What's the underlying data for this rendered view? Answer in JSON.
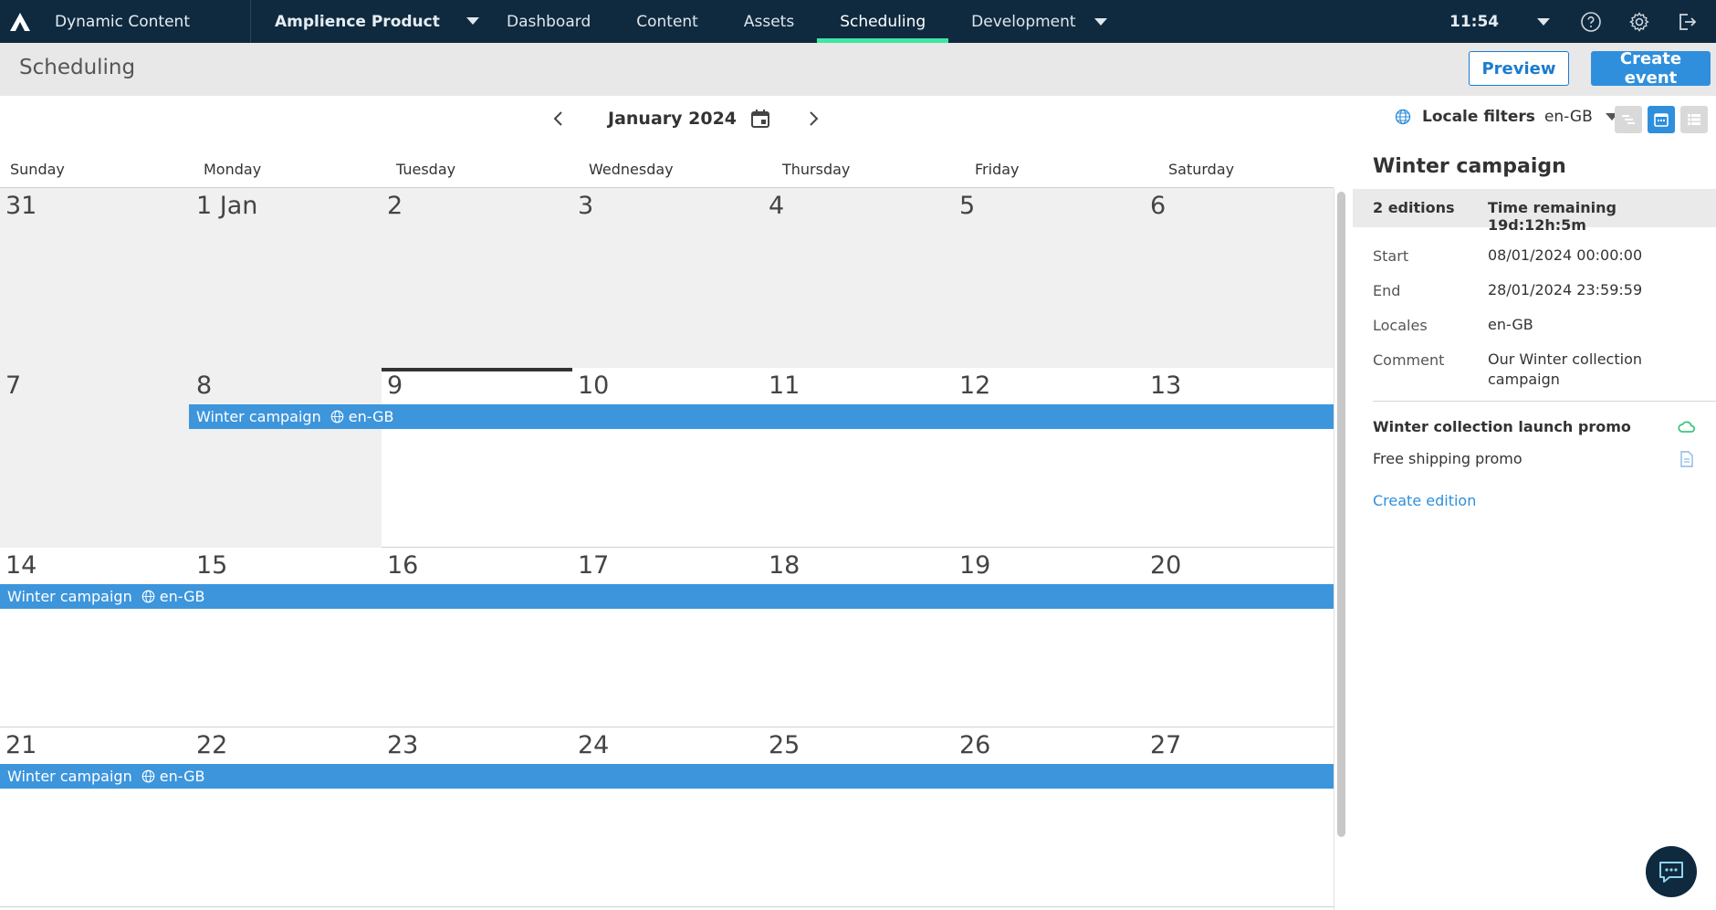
{
  "topbar": {
    "brand_name": "Dynamic Content",
    "product_name": "Amplience Product",
    "tabs": [
      {
        "label": "Dashboard",
        "active": false
      },
      {
        "label": "Content",
        "active": false
      },
      {
        "label": "Assets",
        "active": false
      },
      {
        "label": "Scheduling",
        "active": true
      },
      {
        "label": "Development",
        "active": false
      }
    ],
    "time": "11:54",
    "icons": [
      "help-icon",
      "gear-icon",
      "logout-icon"
    ],
    "bg_color": "#0f2a3f",
    "active_tab_color": "#3ee6a4"
  },
  "page": {
    "title": "Scheduling",
    "preview_label": "Preview",
    "create_event_label": "Create event"
  },
  "calendar": {
    "month_label": "January 2024",
    "weekdays": [
      "Sunday",
      "Monday",
      "Tuesday",
      "Wednesday",
      "Thursday",
      "Friday",
      "Saturday"
    ],
    "weeks": [
      [
        "31",
        "1 Jan",
        "2",
        "3",
        "4",
        "5",
        "6"
      ],
      [
        "7",
        "8",
        "9",
        "10",
        "11",
        "12",
        "13"
      ],
      [
        "14",
        "15",
        "16",
        "17",
        "18",
        "19",
        "20"
      ],
      [
        "21",
        "22",
        "23",
        "24",
        "25",
        "26",
        "27"
      ]
    ],
    "today": "9",
    "event": {
      "name": "Winter campaign",
      "locale": "en-GB",
      "color": "#3d95dc"
    }
  },
  "locale_filter": {
    "label": "Locale filters",
    "value": "en-GB"
  },
  "side_panel": {
    "title": "Winter campaign",
    "editions_count": "2 editions",
    "time_remaining": "Time remaining 19d:12h:5m",
    "props": [
      {
        "label": "Start",
        "value": "08/01/2024 00:00:00"
      },
      {
        "label": "End",
        "value": "28/01/2024 23:59:59"
      },
      {
        "label": "Locales",
        "value": "en-GB"
      },
      {
        "label": "Comment",
        "value": "Our Winter collection campaign"
      }
    ],
    "editions": [
      {
        "name": "Winter collection launch promo",
        "icon": "cloud-icon"
      },
      {
        "name": "Free shipping promo",
        "icon": "document-icon"
      }
    ],
    "create_edition_label": "Create edition"
  }
}
